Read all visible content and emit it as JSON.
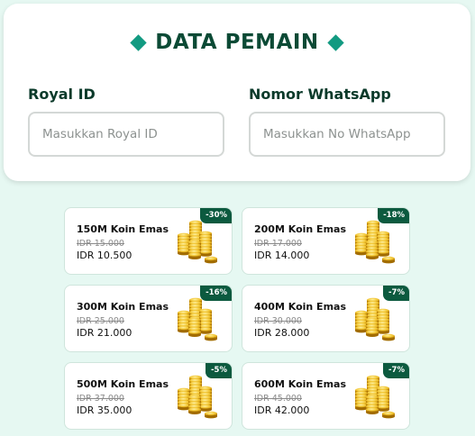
{
  "player_form": {
    "title": "DATA PEMAIN",
    "royal_id": {
      "label": "Royal ID",
      "placeholder": "Masukkan Royal ID",
      "value": ""
    },
    "whatsapp": {
      "label": "Nomor WhatsApp",
      "placeholder": "Masukkan No WhatsApp",
      "value": ""
    }
  },
  "products": [
    {
      "name": "150M Koin Emas",
      "old_price": "IDR 15.000",
      "price": "IDR 10.500",
      "discount": "-30%",
      "icon": "gold-coins-icon"
    },
    {
      "name": "200M Koin Emas",
      "old_price": "IDR 17.000",
      "price": "IDR 14.000",
      "discount": "-18%",
      "icon": "gold-coins-icon"
    },
    {
      "name": "300M Koin Emas",
      "old_price": "IDR 25.000",
      "price": "IDR 21.000",
      "discount": "-16%",
      "icon": "gold-coins-icon"
    },
    {
      "name": "400M Koin Emas",
      "old_price": "IDR 30.000",
      "price": "IDR 28.000",
      "discount": "-7%",
      "icon": "gold-coins-icon"
    },
    {
      "name": "500M Koin Emas",
      "old_price": "IDR 37.000",
      "price": "IDR 35.000",
      "discount": "-5%",
      "icon": "gold-coins-icon"
    },
    {
      "name": "600M Koin Emas",
      "old_price": "IDR 45.000",
      "price": "IDR 42.000",
      "discount": "-7%",
      "icon": "gold-coins-icon"
    }
  ],
  "colors": {
    "accent": "#129a81",
    "title": "#0b4a35",
    "badge": "#0c5a3f",
    "page_background": "#e6f8f2"
  }
}
